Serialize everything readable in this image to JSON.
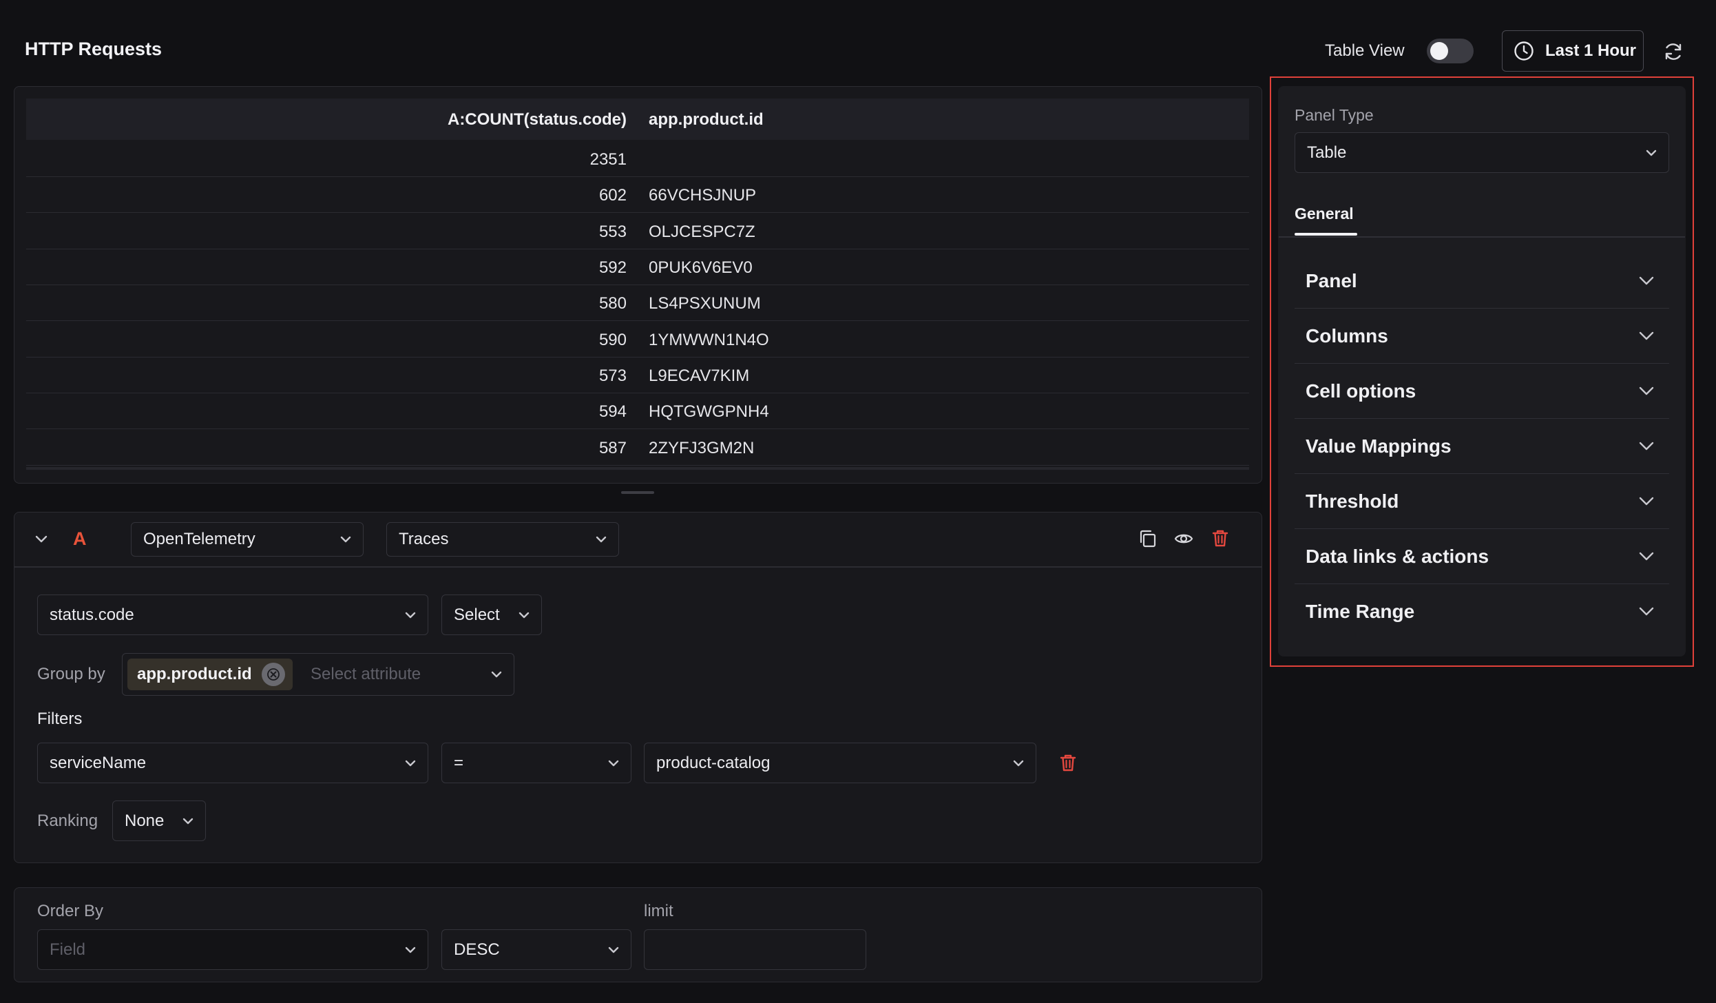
{
  "header": {
    "title": "HTTP Requests",
    "table_view_label": "Table View",
    "table_view_enabled": false,
    "time_range_label": "Last 1 Hour"
  },
  "table": {
    "columns": [
      "A:COUNT(status.code)",
      "app.product.id"
    ],
    "rows": [
      {
        "count": "2351",
        "product_id": ""
      },
      {
        "count": "602",
        "product_id": "66VCHSJNUP"
      },
      {
        "count": "553",
        "product_id": "OLJCESPC7Z"
      },
      {
        "count": "592",
        "product_id": "0PUK6V6EV0"
      },
      {
        "count": "580",
        "product_id": "LS4PSXUNUM"
      },
      {
        "count": "590",
        "product_id": "1YMWWN1N4O"
      },
      {
        "count": "573",
        "product_id": "L9ECAV7KIM"
      },
      {
        "count": "594",
        "product_id": "HQTGWGPNH4"
      },
      {
        "count": "587",
        "product_id": "2ZYFJ3GM2N"
      }
    ]
  },
  "query": {
    "letter": "A",
    "datasource": "OpenTelemetry",
    "signal": "Traces",
    "attribute": "status.code",
    "aggregation": "Select",
    "group_by_label": "Group by",
    "group_by_chip": "app.product.id",
    "group_by_placeholder": "Select attribute",
    "filters_label": "Filters",
    "filter": {
      "field": "serviceName",
      "operator": "=",
      "value": "product-catalog"
    },
    "ranking_label": "Ranking",
    "ranking_value": "None"
  },
  "order": {
    "order_by_label": "Order By",
    "field_placeholder": "Field",
    "direction": "DESC",
    "limit_label": "limit",
    "limit_value": ""
  },
  "options": {
    "panel_type_label": "Panel Type",
    "panel_type_value": "Table",
    "tab_general": "General",
    "sections": [
      "Panel",
      "Columns",
      "Cell options",
      "Value Mappings",
      "Threshold",
      "Data links & actions",
      "Time Range"
    ]
  },
  "colors": {
    "accent_red": "#e0413a",
    "query_letter": "#e8533a",
    "background": "#111114"
  }
}
